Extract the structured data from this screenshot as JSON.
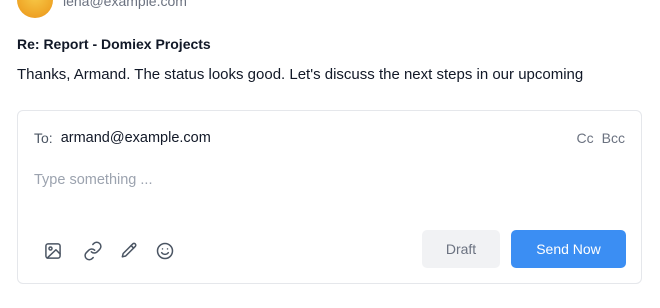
{
  "message": {
    "sender_email": "lena@example.com",
    "subject": "Re: Report - Domiex Projects",
    "body": "Thanks, Armand. The status looks good. Let's discuss the next steps in our upcoming"
  },
  "composer": {
    "to_label": "To:",
    "to_value": "armand@example.com",
    "cc_label": "Cc",
    "bcc_label": "Bcc",
    "placeholder": "Type something ...",
    "toolbar": [
      "image-icon",
      "link-icon",
      "pencil-icon",
      "emoji-icon"
    ],
    "draft_label": "Draft",
    "send_label": "Send Now"
  },
  "colors": {
    "accent": "#3b8ef3",
    "muted_text": "#6b7280",
    "border": "#e5e7eb"
  }
}
